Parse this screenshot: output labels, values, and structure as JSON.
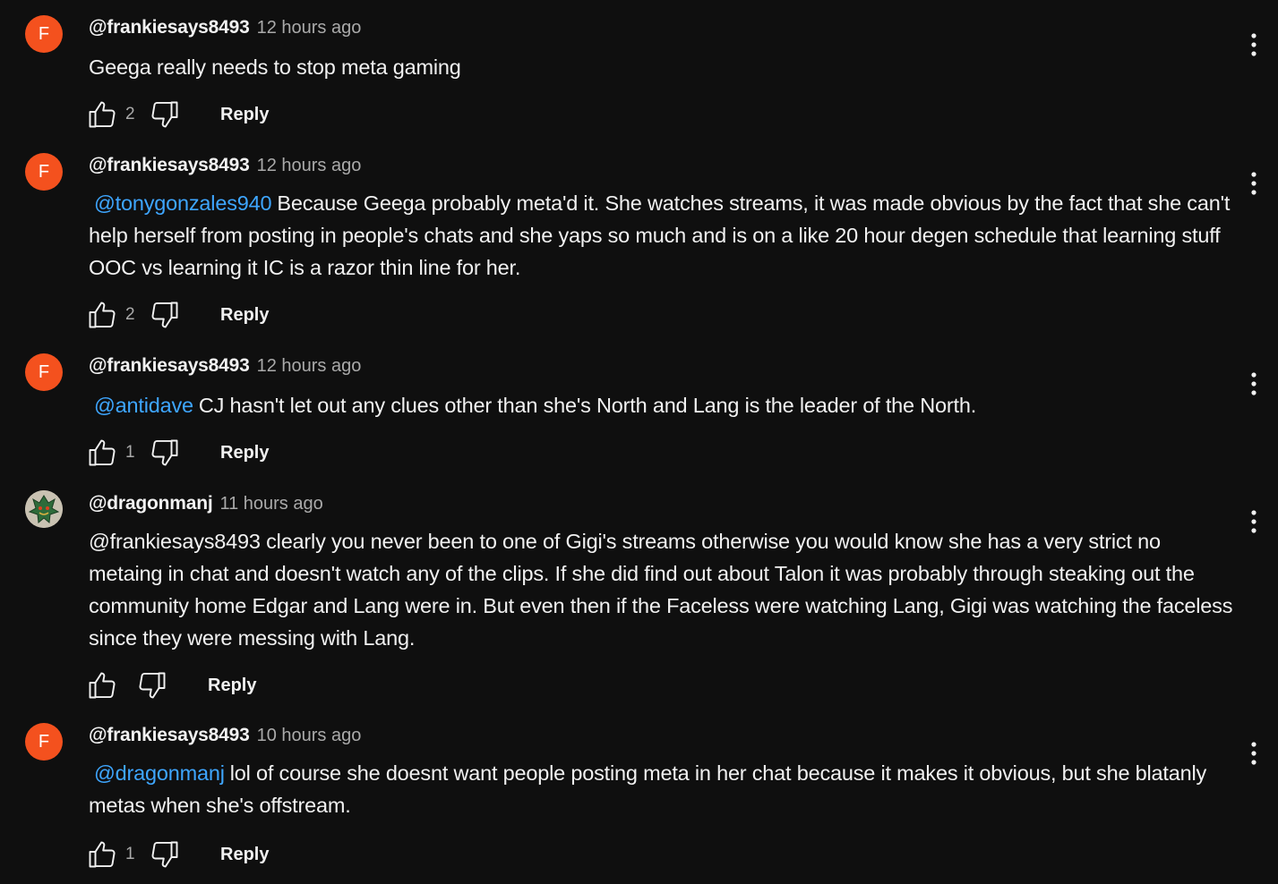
{
  "comments": [
    {
      "author": "@frankiesays8493",
      "avatar_letter": "F",
      "time": "12 hours ago",
      "mention": "",
      "text": "Geega really needs to stop meta gaming",
      "likes": "2",
      "reply_label": "Reply"
    },
    {
      "author": "@frankiesays8493",
      "avatar_letter": "F",
      "time": "12 hours ago",
      "mention": "@tonygonzales940",
      "text": "Because Geega probably meta'd it. She watches streams, it was made obvious by the fact that she can't help herself from posting in people's chats and she yaps so much and is on a like 20 hour degen  schedule that learning stuff OOC vs learning it IC is a razor thin line for her.",
      "likes": "2",
      "reply_label": "Reply"
    },
    {
      "author": "@frankiesays8493",
      "avatar_letter": "F",
      "time": "12 hours ago",
      "mention": "@antidave",
      "text": "CJ hasn't let out any clues other than she's  North and Lang is the leader of the North.",
      "likes": "1",
      "reply_label": "Reply"
    },
    {
      "author": "@dragonmanj",
      "avatar_letter": "",
      "time": "11 hours ago",
      "mention": "",
      "text": "@frankiesays8493  clearly you never been to one of Gigi's streams otherwise you would know she has a very strict no metaing in chat and doesn't watch any of the clips. If she did find out about Talon it was probably through steaking out the community home Edgar and Lang were in. But even then if the Faceless were watching Lang, Gigi was watching the faceless since they were messing with Lang.",
      "likes": "",
      "reply_label": "Reply"
    },
    {
      "author": "@frankiesays8493",
      "avatar_letter": "F",
      "time": "10 hours ago",
      "mention": "@dragonmanj",
      "text": "lol of course she doesnt want people posting meta in her chat because it makes it obvious, but she blatanly metas when she's offstream.",
      "likes": "1",
      "reply_label": "Reply"
    }
  ],
  "colors": {
    "background": "#0f0f0f",
    "text": "#f1f1f1",
    "secondary": "#aaaaaa",
    "mention": "#3ea6ff",
    "avatar_letter_bg": "#f4511e"
  },
  "icons": {
    "like": "thumb-up-outline-icon",
    "dislike": "thumb-down-outline-icon",
    "menu": "more-vertical-icon"
  }
}
